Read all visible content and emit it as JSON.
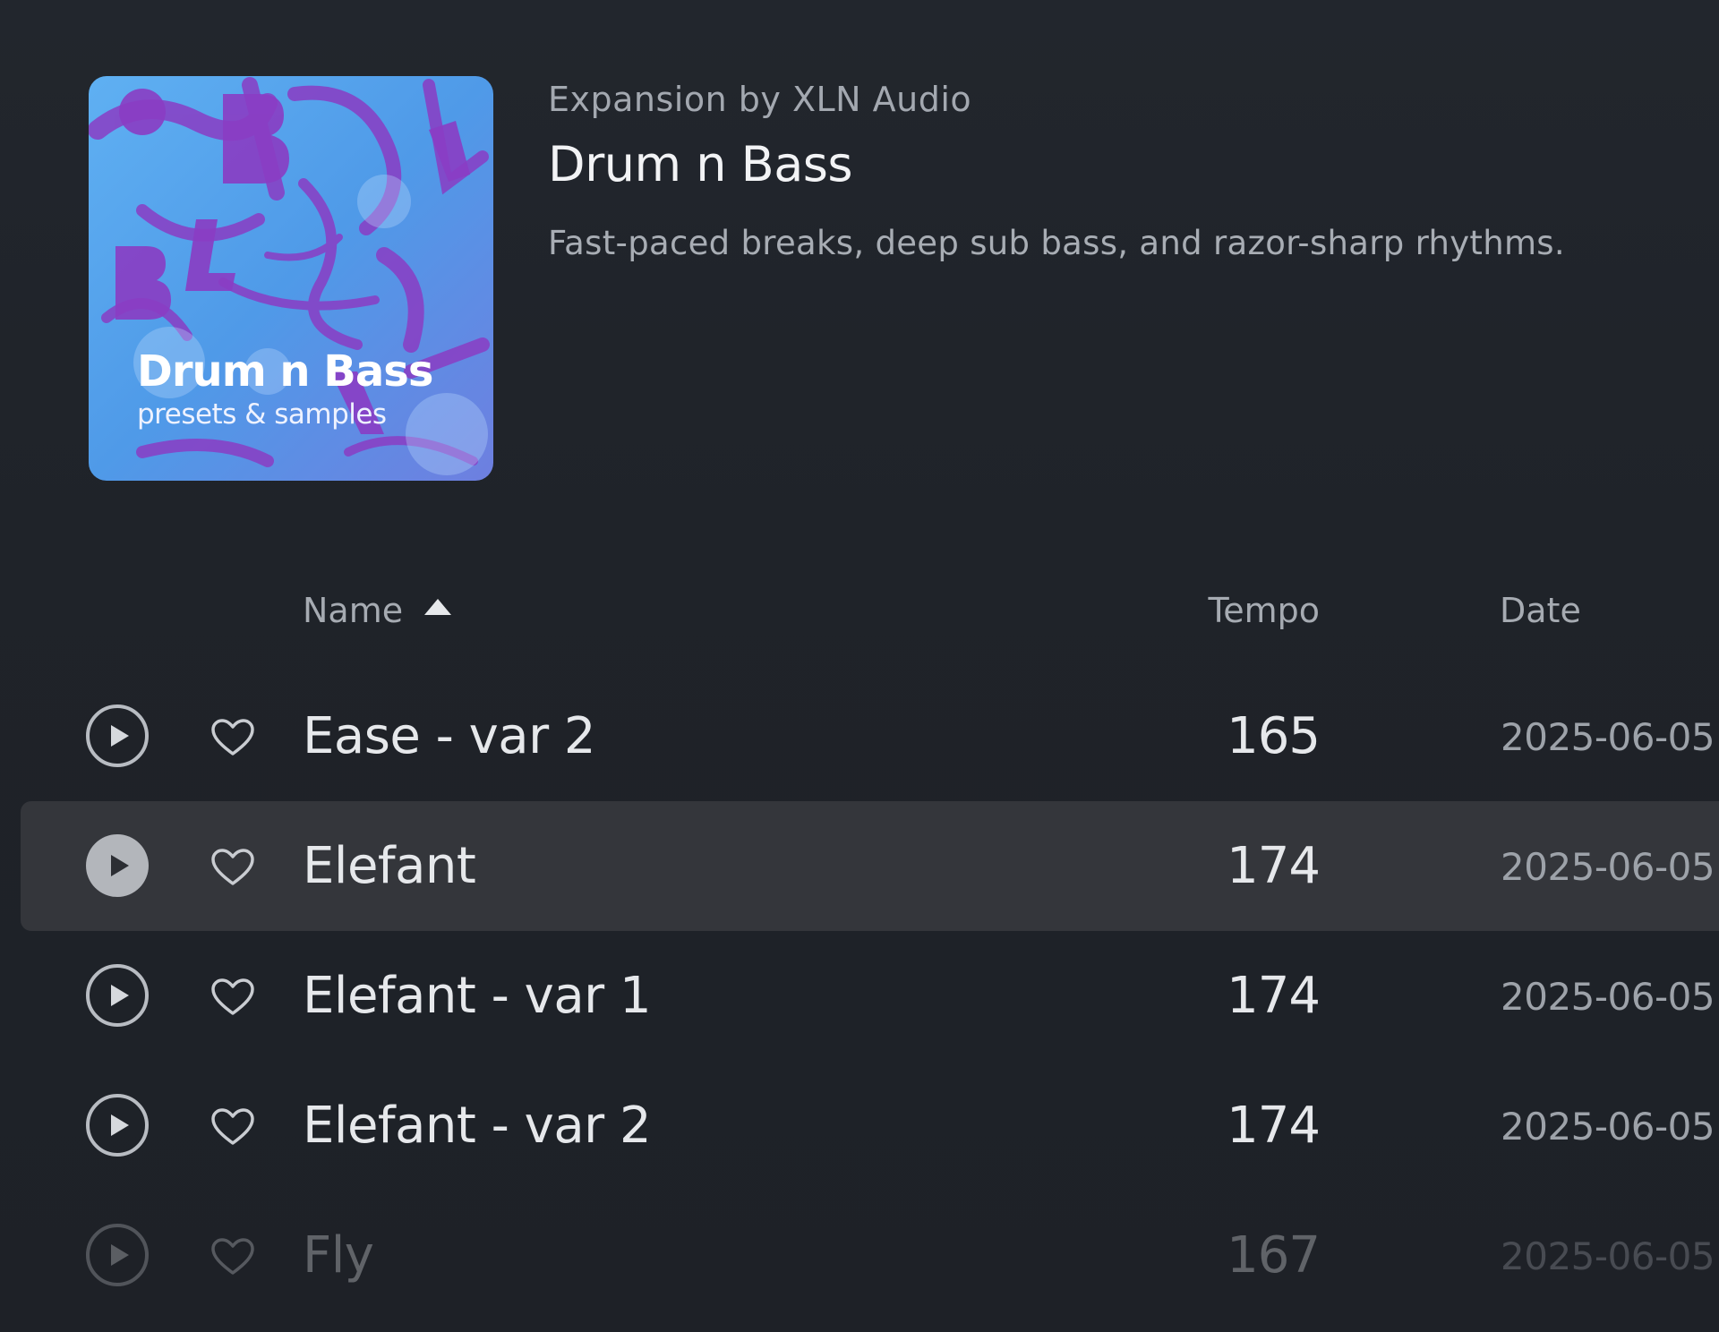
{
  "pack": {
    "publisher": "Expansion by XLN Audio",
    "title": "Drum n Bass",
    "description": "Fast-paced breaks, deep sub bass, and razor-sharp rhythms.",
    "artwork": {
      "title": "Drum n Bass",
      "subtitle": "presets & samples",
      "colors": {
        "base": "#5aa6ee",
        "accent": "#8a3dc4"
      }
    }
  },
  "columns": {
    "name": "Name",
    "tempo": "Tempo",
    "date": "Date",
    "sort": "name-ascending"
  },
  "rows": [
    {
      "name": "Ease - var 2",
      "tempo": "165",
      "date": "2025-06-05",
      "play_icon": "play-outline-icon",
      "favorite_icon": "heart-outline-icon"
    },
    {
      "name": "Elefant",
      "tempo": "174",
      "date": "2025-06-05",
      "play_icon": "play-filled-icon",
      "favorite_icon": "heart-outline-icon"
    },
    {
      "name": "Elefant - var 1",
      "tempo": "174",
      "date": "2025-06-05",
      "play_icon": "play-outline-icon",
      "favorite_icon": "heart-outline-icon"
    },
    {
      "name": "Elefant - var 2",
      "tempo": "174",
      "date": "2025-06-05",
      "play_icon": "play-outline-icon",
      "favorite_icon": "heart-outline-icon"
    },
    {
      "name": "Fly",
      "tempo": "167",
      "date": "2025-06-05",
      "play_icon": "play-outline-icon",
      "favorite_icon": "heart-outline-icon"
    }
  ],
  "colors": {
    "background": "#1f2329",
    "selected_row": "#34363b",
    "text_primary": "#e6e8eb",
    "text_secondary": "#9da2a9"
  }
}
